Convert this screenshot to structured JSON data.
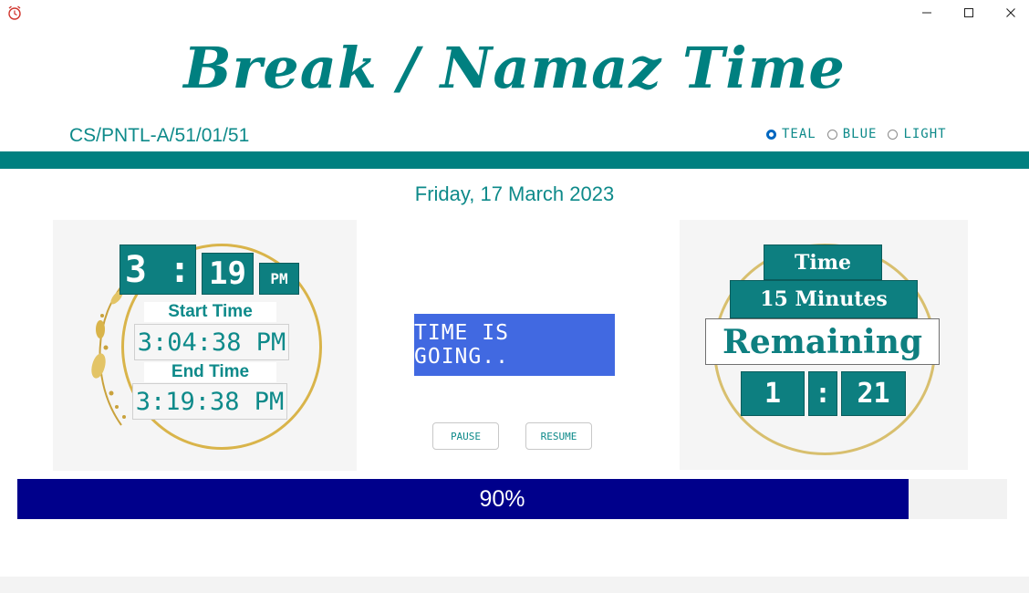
{
  "window": {
    "controls": {
      "minimize": "—",
      "maximize": "☐",
      "close": "✕"
    }
  },
  "header": {
    "title": "Break / Namaz Time",
    "code": "CS/PNTL-A/51/01/51"
  },
  "theme": {
    "options": [
      {
        "label": "TEAL",
        "selected": true
      },
      {
        "label": "BLUE",
        "selected": false
      },
      {
        "label": "LIGHT",
        "selected": false
      }
    ]
  },
  "date": "Friday, 17 March 2023",
  "clock": {
    "hour": "3",
    "separator": ":",
    "minute": "19",
    "ampm": "PM",
    "start_label": "Start Time",
    "start_value": "3:04:38 PM",
    "end_label": "End Time",
    "end_value": "3:19:38 PM"
  },
  "status": {
    "text": "TIME IS GOING..",
    "pause_label": "PAUSE",
    "resume_label": "RESUME"
  },
  "countdown": {
    "time_label": "Time",
    "duration_label": "15 Minutes",
    "remaining_label": "Remaining",
    "minutes": "1",
    "separator": ":",
    "seconds": "21"
  },
  "progress": {
    "percent": 90,
    "label": "90%"
  },
  "colors": {
    "accent": "#008080",
    "status_bg": "#4169e1",
    "progress": "#00008b",
    "gold": "#d9b44a"
  }
}
